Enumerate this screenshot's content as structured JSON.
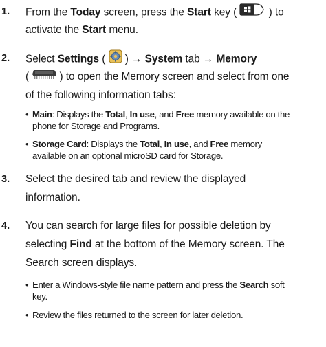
{
  "steps": [
    {
      "num": "1.",
      "l1a": "From the ",
      "l1b": "Today",
      "l1c": " screen, press the ",
      "l1d": "Start",
      "l1e": " key (",
      "l1f": ") to",
      "l2a": "activate the ",
      "l2b": "Start",
      "l2c": " menu."
    },
    {
      "num": "2.",
      "l1a": "Select ",
      "l1b": "Settings",
      "l1c": " (",
      "l1d": ") → ",
      "l1e": "System",
      "l1f": " tab → ",
      "l1g": "Memory",
      "l2a": "(",
      "l2b": ") to open the Memory screen and select from one",
      "l3": "of the following information tabs:",
      "bullets": [
        {
          "a": "Main",
          "b": ": Displays the ",
          "c": "Total",
          "d": ", ",
          "e": "In use",
          "f": ", and ",
          "g": "Free",
          "h": " memory available on the",
          "i": "phone for Storage and Programs."
        },
        {
          "a": "Storage Card",
          "b": ": Displays the ",
          "c": "Total",
          "d": ", ",
          "e": "In use",
          "f": ", and ",
          "g": "Free",
          "h": " memory",
          "i": "available on an optional microSD card for Storage."
        }
      ]
    },
    {
      "num": "3.",
      "l1": "Select the desired tab and review the displayed",
      "l2": "information."
    },
    {
      "num": "4.",
      "l1": "You can search for large files for possible deletion by",
      "l2a": "selecting ",
      "l2b": "Find",
      "l2c": " at the bottom of the Memory screen. The",
      "l3": "Search screen displays.",
      "bullets": [
        {
          "a": "Enter a Windows-style file name pattern and press the ",
          "b": "Search",
          "c": " soft",
          "d": "key."
        },
        {
          "a": "Review the files returned to the screen for later deletion."
        }
      ]
    }
  ],
  "icons": {
    "start_key": "windows-start-key-icon",
    "settings": "settings-gear-icon",
    "memory": "memory-chip-icon"
  }
}
